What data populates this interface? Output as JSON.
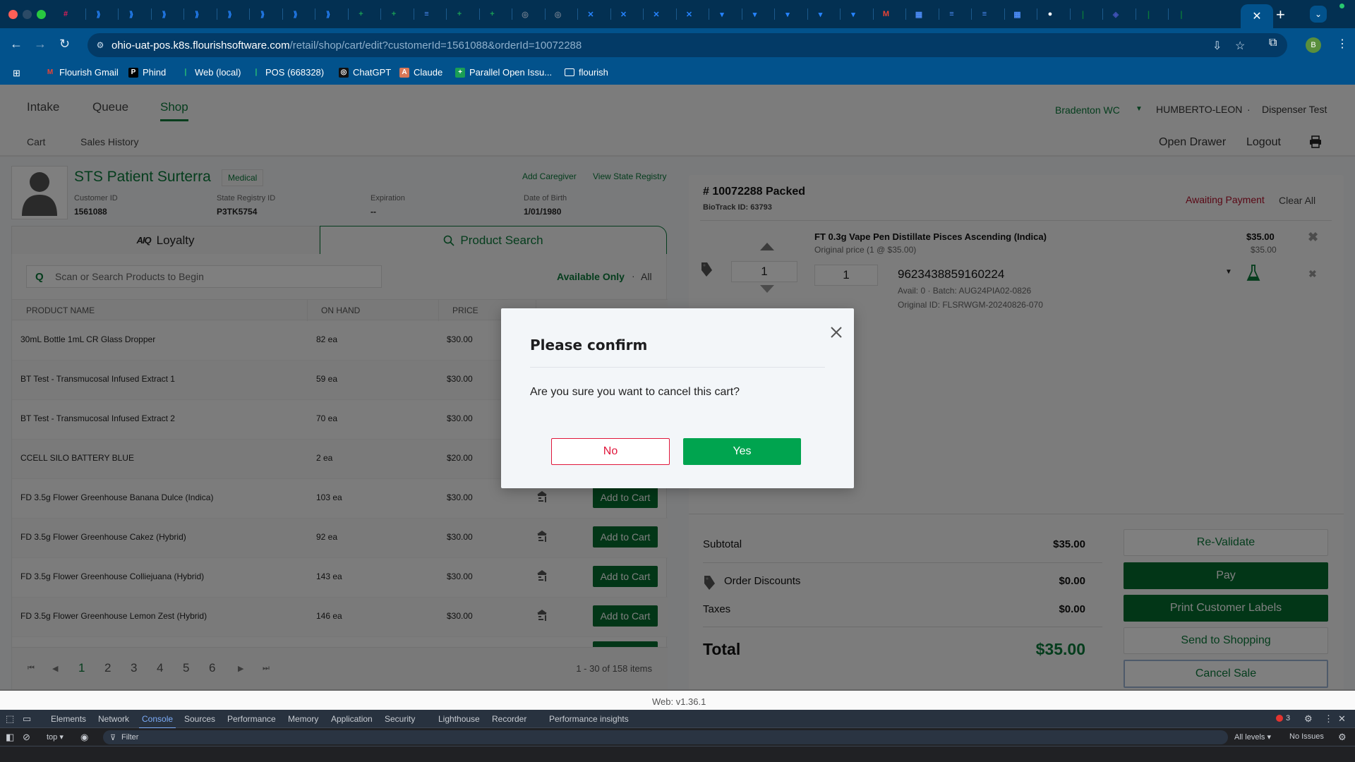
{
  "browser": {
    "tabs": {
      "favicons": [
        "slack-icon",
        "jira-icon",
        "jira-icon",
        "jira-icon",
        "jira-icon",
        "jira-icon",
        "jira-icon",
        "jira-icon",
        "jira-icon",
        "flourish-icon",
        "flourish-icon",
        "docs-icon",
        "flourish-icon",
        "flourish-icon",
        "openai-icon",
        "openai-icon",
        "confluence-icon",
        "confluence-icon",
        "confluence-icon",
        "confluence-icon",
        "bitbucket-icon",
        "bitbucket-icon",
        "bitbucket-icon",
        "bitbucket-icon",
        "bitbucket-icon",
        "gmail-icon",
        "calendar-icon",
        "docs-icon",
        "docs-icon",
        "calendar-icon",
        "avatar-icon",
        "leaf-icon",
        "app-icon",
        "leaf-icon",
        "leaf-icon"
      ],
      "active_close": "✕",
      "new_tab": "+",
      "profile_initial": "B"
    },
    "url_host": "ohio-uat-pos.k8s.flourishsoftware.com",
    "url_path": "/retail/shop/cart/edit?customerId=1561088&orderId=10072288",
    "bookmarks": [
      {
        "label": "Flourish Gmail",
        "icon": "gmail-icon",
        "glyph": "M",
        "color": "#ea4335"
      },
      {
        "label": "Phind",
        "icon": "phind-icon",
        "glyph": "P",
        "color": "#000000"
      },
      {
        "label": "Web (local)",
        "icon": "leaf-icon",
        "glyph": "❘",
        "color": "#0b7a3a"
      },
      {
        "label": "POS (668328)",
        "icon": "leaf-icon",
        "glyph": "❘",
        "color": "#0b7a3a"
      },
      {
        "label": "ChatGPT",
        "icon": "openai-icon",
        "glyph": "◎",
        "color": "#111111"
      },
      {
        "label": "Claude",
        "icon": "anthropic-icon",
        "glyph": "A",
        "color": "#d97757"
      },
      {
        "label": "Parallel Open Issu...",
        "icon": "sheets-icon",
        "glyph": "+",
        "color": "#1a9e55"
      },
      {
        "label": "flourish",
        "icon": "folder-icon",
        "glyph": "▭",
        "color": "transparent"
      }
    ]
  },
  "app": {
    "nav": {
      "tabs": [
        "Intake",
        "Queue",
        "Shop"
      ],
      "active": "Shop"
    },
    "subnav": [
      "Cart",
      "Sales History"
    ],
    "store": "Bradenton WC",
    "user": "HUMBERTO-LEON",
    "separator": "·",
    "role": "Dispenser Test",
    "open_drawer": "Open Drawer",
    "logout": "Logout",
    "customer": {
      "name": "STS Patient Surterra",
      "type_badge": "Medical",
      "add_caregiver": "Add Caregiver",
      "view_registry": "View State Registry",
      "fields": [
        {
          "label": "Customer ID",
          "value": "1561088"
        },
        {
          "label": "State Registry ID",
          "value": "P3TK5754"
        },
        {
          "label": "Expiration",
          "value": "--"
        },
        {
          "label": "Date of Birth",
          "value": "1/01/1980"
        }
      ]
    },
    "search_tabs": {
      "loyalty": "Loyalty",
      "loyalty_logo": "AIQ",
      "product_search": "Product Search"
    },
    "search": {
      "placeholder": "Scan or Search Products to Begin",
      "value": ""
    },
    "filter": {
      "available_only": "Available Only",
      "dot": "·",
      "all": "All"
    },
    "table": {
      "headers": [
        "PRODUCT NAME",
        "ON HAND",
        "PRICE"
      ],
      "add_label": "Add to Cart",
      "rows": [
        {
          "name": "30mL Bottle 1mL CR Glass Dropper",
          "on_hand": "82 ea",
          "price": "$30.00"
        },
        {
          "name": "BT Test - Transmucosal Infused Extract 1",
          "on_hand": "59 ea",
          "price": "$30.00"
        },
        {
          "name": "BT Test - Transmucosal Infused Extract 2",
          "on_hand": "70 ea",
          "price": "$30.00"
        },
        {
          "name": "CCELL SILO BATTERY BLUE",
          "on_hand": "2 ea",
          "price": "$20.00"
        },
        {
          "name": "FD 3.5g Flower Greenhouse Banana Dulce (Indica)",
          "on_hand": "103 ea",
          "price": "$30.00"
        },
        {
          "name": "FD 3.5g Flower Greenhouse Cakez (Hybrid)",
          "on_hand": "92 ea",
          "price": "$30.00"
        },
        {
          "name": "FD 3.5g Flower Greenhouse Colliejuana (Hybrid)",
          "on_hand": "143 ea",
          "price": "$30.00"
        },
        {
          "name": "FD 3.5g Flower Greenhouse Lemon Zest (Hybrid)",
          "on_hand": "146 ea",
          "price": "$30.00"
        }
      ]
    },
    "pagination": {
      "pages": [
        "1",
        "2",
        "3",
        "4",
        "5",
        "6"
      ],
      "current": "1",
      "info": "1 - 30 of 158 items"
    },
    "cart": {
      "order_title": "# 10072288 Packed",
      "biotrack": "BioTrack ID: 63793",
      "status": "Awaiting Payment",
      "clear_all": "Clear All",
      "line": {
        "name": "FT 0.3g Vape Pen Distillate Pisces Ascending (Indica)",
        "original_price": "Original price (1 @ $35.00)",
        "price": "$35.00",
        "price_sub": "$35.00",
        "quantity": "1",
        "package_qty": "1",
        "package_id": "9623438859160224",
        "avail_batch": "Avail: 0 · Batch: AUG24PIA02-0826",
        "original_id": "Original ID: FLSRWGM-20240826-070"
      }
    },
    "totals": {
      "subtotal_label": "Subtotal",
      "subtotal": "$35.00",
      "discounts_label": "Order Discounts",
      "discounts": "$0.00",
      "taxes_label": "Taxes",
      "taxes": "$0.00",
      "total_label": "Total",
      "total": "$35.00"
    },
    "actions": {
      "revalidate": "Re-Validate",
      "pay": "Pay",
      "print_labels": "Print Customer Labels",
      "send_to_shopping": "Send to Shopping",
      "cancel_sale": "Cancel Sale"
    },
    "version": "Web: v1.36.1"
  },
  "modal": {
    "title": "Please confirm",
    "message": "Are you sure you want to cancel this cart?",
    "no": "No",
    "yes": "Yes"
  },
  "devtools": {
    "tabs": [
      "Elements",
      "Network",
      "Console",
      "Sources",
      "Performance",
      "Memory",
      "Application",
      "Security",
      "Lighthouse",
      "Recorder",
      "Performance insights"
    ],
    "active_tab": "Console",
    "context": "top ▾",
    "filter_placeholder": "Filter",
    "levels": "All levels ▾",
    "issues": "No Issues",
    "error_count": "3"
  }
}
